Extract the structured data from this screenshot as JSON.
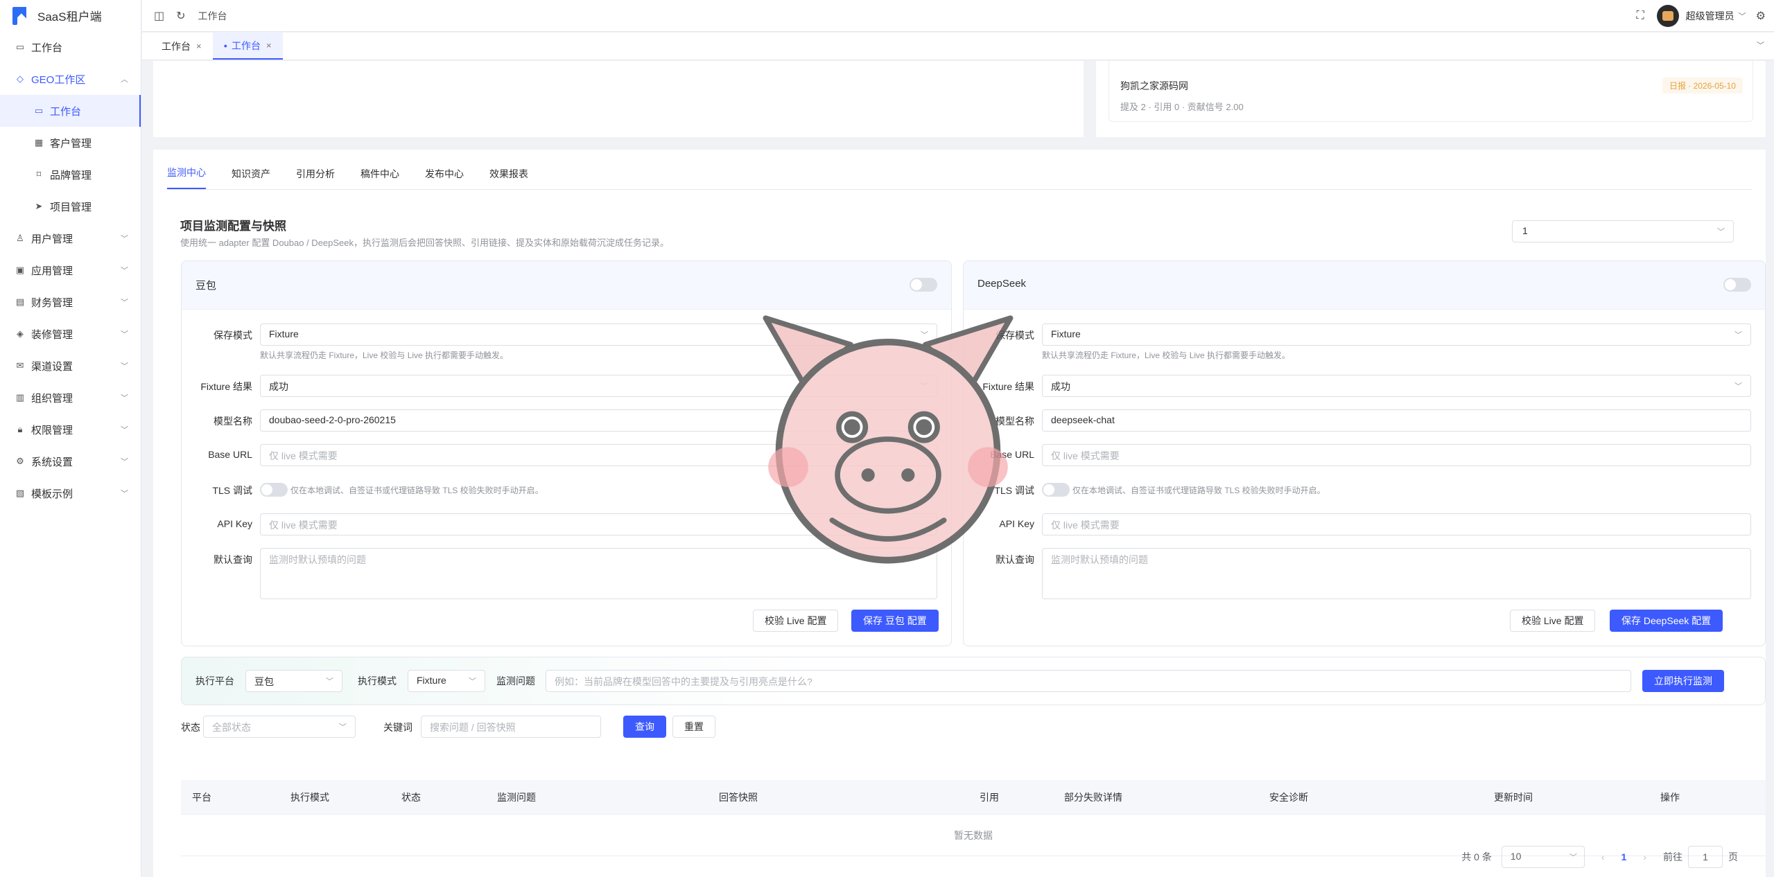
{
  "app": {
    "title": "SaaS租户端"
  },
  "sidebar": {
    "items": [
      {
        "label": "工作台",
        "icon": "monitor-icon"
      },
      {
        "label": "GEO工作区",
        "icon": "geo-icon"
      },
      {
        "label": "工作台",
        "icon": "monitor-icon"
      },
      {
        "label": "客户管理",
        "icon": "building-icon"
      },
      {
        "label": "品牌管理",
        "icon": "bookmark-icon"
      },
      {
        "label": "项目管理",
        "icon": "send-icon"
      },
      {
        "label": "用户管理",
        "icon": "user-icon"
      },
      {
        "label": "应用管理",
        "icon": "app-icon"
      },
      {
        "label": "财务管理",
        "icon": "chart-icon"
      },
      {
        "label": "装修管理",
        "icon": "tag-icon"
      },
      {
        "label": "渠道设置",
        "icon": "mail-icon"
      },
      {
        "label": "组织管理",
        "icon": "org-icon"
      },
      {
        "label": "权限管理",
        "icon": "lock-icon"
      },
      {
        "label": "系统设置",
        "icon": "gear-icon"
      },
      {
        "label": "模板示例",
        "icon": "template-icon"
      }
    ]
  },
  "topbar": {
    "breadcrumb": "工作台",
    "user": "超级管理员"
  },
  "page_tabs": [
    {
      "label": "工作台"
    },
    {
      "label": "工作台"
    }
  ],
  "record": {
    "name": "狗凯之家源码网",
    "meta": "提及 2 · 引用 0 · 贡献信号 2.00",
    "tag": "日报 · 2026-05-10"
  },
  "subtabs": [
    "监测中心",
    "知识资产",
    "引用分析",
    "稿件中心",
    "发布中心",
    "效果报表"
  ],
  "section": {
    "title": "项目监测配置与快照",
    "desc": "使用统一 adapter 配置 Doubao / DeepSeek，执行监测后会把回答快照、引用链接、提及实体和原始载荷沉淀成任务记录。",
    "project_value": "1"
  },
  "labels": {
    "save_mode": "保存模式",
    "fixture_result": "Fixture 结果",
    "model_name": "模型名称",
    "base_url": "Base URL",
    "tls": "TLS 调试",
    "api_key": "API Key",
    "default_query": "默认查询",
    "mode_hint": "默认共享流程仍走 Fixture，Live 校验与 Live 执行都需要手动触发。",
    "tls_hint": "仅在本地调试、自签证书或代理链路导致 TLS 校验失败时手动开启。",
    "base_url_ph": "仅 live 模式需要",
    "api_key_ph": "仅 live 模式需要",
    "query_ph": "监测时默认预填的问题",
    "verify_btn": "校验 Live 配置"
  },
  "panels": {
    "doubao": {
      "name": "豆包",
      "mode": "Fixture",
      "result": "成功",
      "model": "doubao-seed-2-0-pro-260215",
      "save_btn": "保存 豆包 配置"
    },
    "deepseek": {
      "name": "DeepSeek",
      "mode": "Fixture",
      "result": "成功",
      "model": "deepseek-chat",
      "save_btn": "保存 DeepSeek 配置"
    }
  },
  "exec": {
    "platform_label": "执行平台",
    "platform": "豆包",
    "mode_label": "执行模式",
    "mode": "Fixture",
    "question_label": "监测问题",
    "question_ph": "例如：当前品牌在模型回答中的主要提及与引用亮点是什么?",
    "run_btn": "立即执行监测"
  },
  "filter": {
    "status_label": "状态",
    "status_ph": "全部状态",
    "keyword_label": "关键词",
    "keyword_ph": "搜索问题 / 回答快照",
    "query_btn": "查询",
    "reset_btn": "重置"
  },
  "table": {
    "columns": [
      "平台",
      "执行模式",
      "状态",
      "监测问题",
      "回答快照",
      "引用",
      "部分失败详情",
      "安全诊断",
      "更新时间",
      "操作"
    ],
    "empty": "暂无数据"
  },
  "pager": {
    "total": "共 0 条",
    "size": "10",
    "page": "1",
    "goto": "前往",
    "goto_value": "1",
    "page_unit": "页"
  }
}
